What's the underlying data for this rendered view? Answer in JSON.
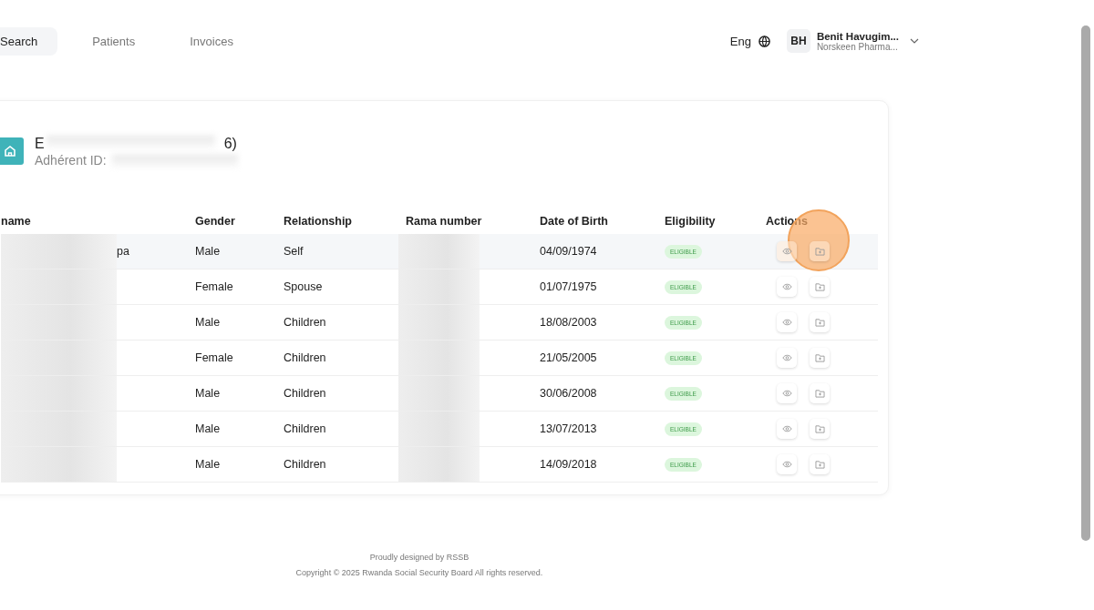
{
  "nav": {
    "tabs": [
      {
        "label": "Search",
        "selected": true
      },
      {
        "label": "Patients",
        "selected": false
      },
      {
        "label": "Invoices",
        "selected": false
      }
    ],
    "language": "Eng",
    "user": {
      "initials": "BH",
      "name": "Benit Havugim...",
      "organization": "Norskeen Pharma..."
    }
  },
  "family": {
    "title_start": "E",
    "title_end": "6)",
    "id_label": "Adhérent ID:"
  },
  "table": {
    "columns": [
      "name",
      "Gender",
      "Relationship",
      "Rama number",
      "Date of Birth",
      "Eligibility",
      "Actions"
    ],
    "rows": [
      {
        "name": "pa",
        "gender": "Male",
        "relationship": "Self",
        "date_of_birth": "04/09/1974",
        "eligibility": "ELIGIBLE",
        "eligible": true,
        "highlighted": true
      },
      {
        "gender": "Female",
        "relationship": "Spouse",
        "date_of_birth": "01/07/1975",
        "eligibility": "ELIGIBLE",
        "eligible": true,
        "highlighted": false
      },
      {
        "gender": "Male",
        "relationship": "Children",
        "date_of_birth": "18/08/2003",
        "eligibility": "ELIGIBLE",
        "eligible": true,
        "highlighted": false
      },
      {
        "gender": "Female",
        "relationship": "Children",
        "date_of_birth": "21/05/2005",
        "eligibility": "ELIGIBLE",
        "eligible": true,
        "highlighted": false
      },
      {
        "gender": "Male",
        "relationship": "Children",
        "date_of_birth": "30/06/2008",
        "eligibility": "ELIGIBLE",
        "eligible": true,
        "highlighted": false
      },
      {
        "gender": "Male",
        "relationship": "Children",
        "date_of_birth": "13/07/2013",
        "eligibility": "ELIGIBLE",
        "eligible": true,
        "highlighted": false
      },
      {
        "gender": "Male",
        "relationship": "Children",
        "date_of_birth": "14/09/2018",
        "eligibility": "ELIGIBLE",
        "eligible": true,
        "highlighted": false
      }
    ]
  },
  "footer": {
    "credit": "Proudly designed by RSSB",
    "copyright": "Copyright © 2025 Rwanda Social Security Board All rights reserved."
  }
}
